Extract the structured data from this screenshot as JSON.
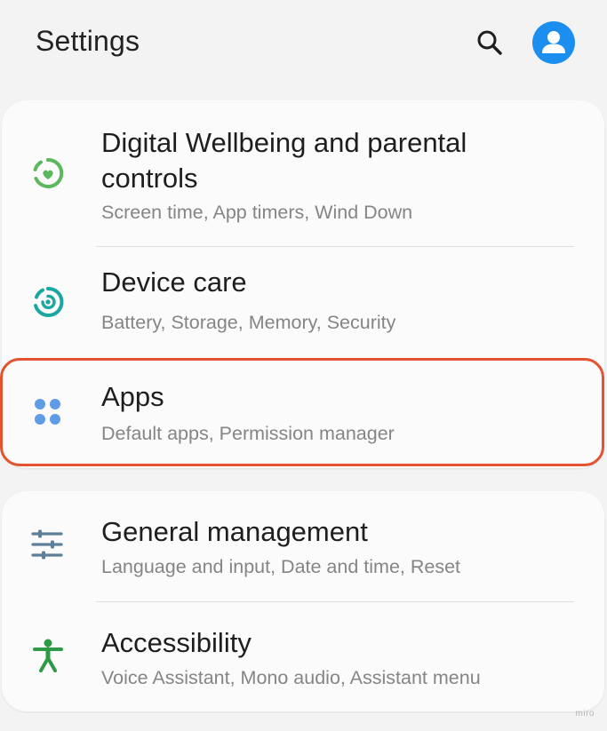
{
  "header": {
    "title": "Settings",
    "search_icon": "search-icon",
    "avatar_icon": "person-icon",
    "accent_color": "#1b8ef0"
  },
  "groups": [
    {
      "items": [
        {
          "title": "Digital Wellbeing and parental controls",
          "subtitle": "Screen time, App timers, Wind Down",
          "icon": "digital-wellbeing-icon",
          "icon_color": "#5cb85c"
        },
        {
          "title": "Device care",
          "subtitle": "Battery, Storage, Memory, Security",
          "icon": "device-care-icon",
          "icon_color": "#19a8a0"
        },
        {
          "title": "Apps",
          "subtitle": "Default apps, Permission manager",
          "icon": "apps-icon",
          "icon_color": "#5f9be6",
          "highlighted": true
        }
      ]
    },
    {
      "items": [
        {
          "title": "General management",
          "subtitle": "Language and input, Date and time, Reset",
          "icon": "sliders-icon",
          "icon_color": "#5d7f99"
        },
        {
          "title": "Accessibility",
          "subtitle": "Voice Assistant, Mono audio, Assistant menu",
          "icon": "accessibility-icon",
          "icon_color": "#2e9a45"
        }
      ]
    }
  ],
  "highlight_color": "#e4532f",
  "watermark": "miro"
}
